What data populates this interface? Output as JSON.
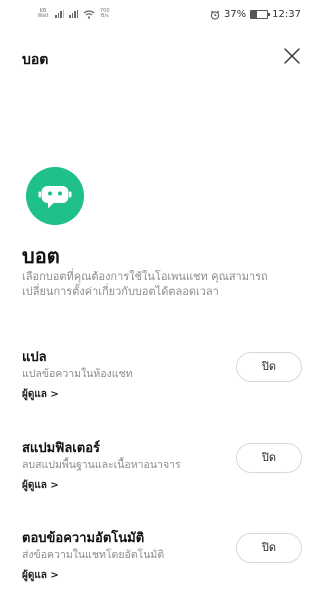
{
  "status_bar": {
    "left_tiny_text": "KB Wait",
    "speed_value": "700",
    "speed_unit": "B/s",
    "alarm_icon": "alarm-icon",
    "battery_text": "37%",
    "battery_level": 0.37,
    "time": "12:37"
  },
  "header": {
    "title": "บอต",
    "close_icon": "close-icon"
  },
  "bot_icon": {
    "name": "robot-chat-icon",
    "color": "#1fc08c"
  },
  "page": {
    "title": "บอต",
    "description": "เลือกบอตที่คุณต้องการใช้ในโอเพนแชท คุณสามารถเปลี่ยนการตั้งค่าเกี่ยวกับบอตได้ตลอดเวลา"
  },
  "features": [
    {
      "title": "แปล",
      "description": "แปลข้อความในห้องแชท",
      "manage": "ผู้ดูแล >",
      "toggle": "ปิด"
    },
    {
      "title": "สแปมฟิลเตอร์",
      "description": "ลบสแปมพื้นฐานและเนื้อหาอนาจาร",
      "manage": "ผู้ดูแล >",
      "toggle": "ปิด"
    },
    {
      "title": "ตอบข้อความอัตโนมัติ",
      "description": "ส่งข้อความในแชทโดยอัตโนมัติ",
      "manage": "ผู้ดูแล >",
      "toggle": "ปิด"
    }
  ]
}
